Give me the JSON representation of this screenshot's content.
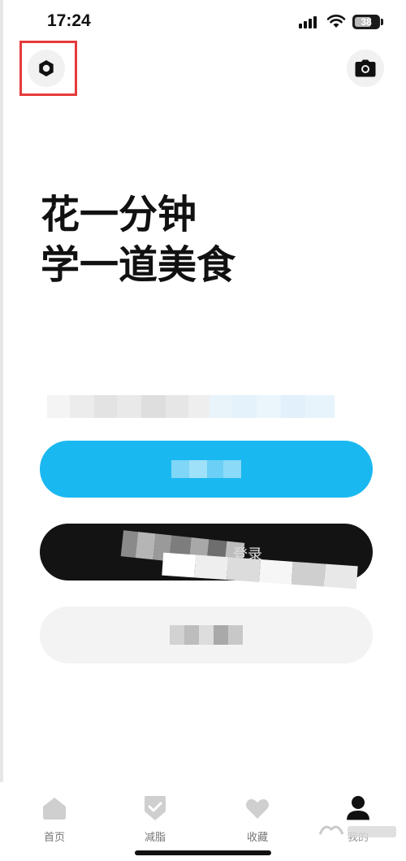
{
  "status_bar": {
    "time": "17:24",
    "battery": "38"
  },
  "header": {
    "settings_icon": "hexagon-settings-icon",
    "camera_icon": "camera-icon"
  },
  "hero": {
    "line1": "花一分钟",
    "line2": "学一道美食"
  },
  "wechat_login_visible_text": "登录",
  "tabs": [
    {
      "label": "首页",
      "icon": "home-icon",
      "active": false
    },
    {
      "label": "减脂",
      "icon": "shield-check-icon",
      "active": false
    },
    {
      "label": "收藏",
      "icon": "heart-icon",
      "active": false
    },
    {
      "label": "我的",
      "icon": "person-icon",
      "active": true
    }
  ],
  "colors": {
    "primary": "#1ab8f0",
    "dark_button": "#131313",
    "light_button": "#f3f3f3",
    "highlight": "#e63a3a",
    "tab_icon_inactive": "#cfcfcf"
  }
}
